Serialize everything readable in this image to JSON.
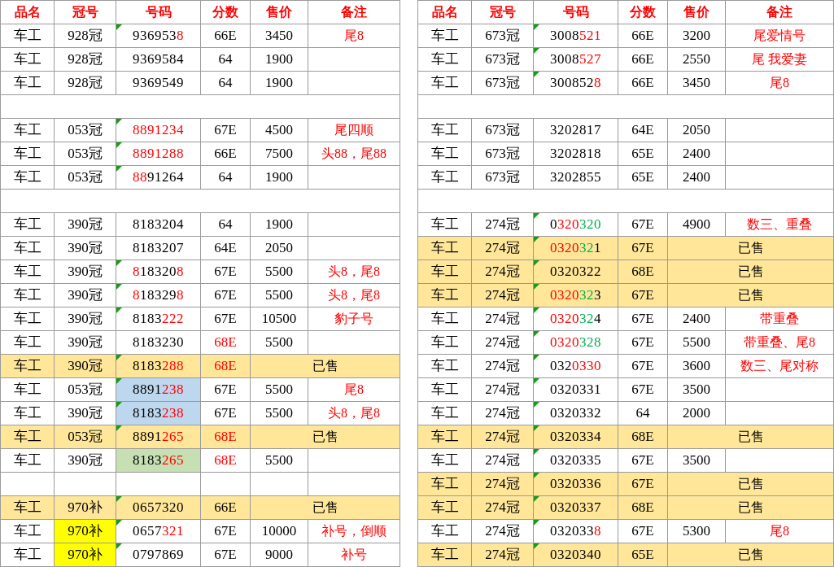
{
  "tables": [
    {
      "columns": [
        "品名",
        "冠号",
        "号码",
        "分数",
        "售价",
        "备注"
      ],
      "rows": [
        {
          "kind": "item",
          "name": "车工",
          "crown": {
            "text": "928冠"
          },
          "marker": true,
          "number": {
            "parts": [
              {
                "text": "936953"
              },
              {
                "text": "8",
                "color": "#ff0000"
              }
            ]
          },
          "score": {
            "text": "66E"
          },
          "price": "3450",
          "note": "尾8"
        },
        {
          "kind": "item",
          "name": "车工",
          "crown": {
            "text": "928冠"
          },
          "marker": false,
          "number": {
            "parts": [
              {
                "text": "9369584"
              }
            ]
          },
          "score": {
            "text": "64"
          },
          "price": "1900"
        },
        {
          "kind": "item",
          "name": "车工",
          "crown": {
            "text": "928冠"
          },
          "marker": false,
          "number": {
            "parts": [
              {
                "text": "9369549"
              }
            ]
          },
          "score": {
            "text": "64"
          },
          "price": "1900"
        },
        {
          "kind": "gap"
        },
        {
          "kind": "item",
          "name": "车工",
          "crown": {
            "text": "053冠"
          },
          "marker": true,
          "number": {
            "parts": [
              {
                "text": "8891234",
                "color": "#ff0000"
              }
            ]
          },
          "score": {
            "text": "67E"
          },
          "price": "4500",
          "note": "尾四顺"
        },
        {
          "kind": "item",
          "name": "车工",
          "crown": {
            "text": "053冠"
          },
          "marker": true,
          "number": {
            "parts": [
              {
                "text": "8891288",
                "color": "#ff0000"
              }
            ]
          },
          "score": {
            "text": "66E"
          },
          "price": "7500",
          "note": "头88，尾88"
        },
        {
          "kind": "item",
          "name": "车工",
          "crown": {
            "text": "053冠"
          },
          "marker": true,
          "number": {
            "parts": [
              {
                "text": "88",
                "color": "#ff0000"
              },
              {
                "text": "91264"
              }
            ]
          },
          "score": {
            "text": "64"
          },
          "price": "1900"
        },
        {
          "kind": "gap"
        },
        {
          "kind": "item",
          "name": "车工",
          "crown": {
            "text": "390冠"
          },
          "marker": false,
          "number": {
            "parts": [
              {
                "text": "8183204"
              }
            ]
          },
          "score": {
            "text": "64"
          },
          "price": "1900"
        },
        {
          "kind": "item",
          "name": "车工",
          "crown": {
            "text": "390冠"
          },
          "marker": false,
          "number": {
            "parts": [
              {
                "text": "8183207"
              }
            ]
          },
          "score": {
            "text": "64E"
          },
          "price": "2050"
        },
        {
          "kind": "item",
          "name": "车工",
          "crown": {
            "text": "390冠"
          },
          "marker": true,
          "number": {
            "parts": [
              {
                "text": "8",
                "color": "#ff0000"
              },
              {
                "text": "18320"
              },
              {
                "text": "8",
                "color": "#ff0000"
              }
            ]
          },
          "score": {
            "text": "67E"
          },
          "price": "5500",
          "note": "头8，尾8"
        },
        {
          "kind": "item",
          "name": "车工",
          "crown": {
            "text": "390冠"
          },
          "marker": true,
          "number": {
            "parts": [
              {
                "text": "8",
                "color": "#ff0000"
              },
              {
                "text": "18329"
              },
              {
                "text": "8",
                "color": "#ff0000"
              }
            ]
          },
          "score": {
            "text": "67E"
          },
          "price": "5500",
          "note": "头8，尾8"
        },
        {
          "kind": "item",
          "name": "车工",
          "crown": {
            "text": "390冠"
          },
          "marker": true,
          "number": {
            "parts": [
              {
                "text": "8183"
              },
              {
                "text": "222",
                "color": "#ff0000"
              }
            ]
          },
          "score": {
            "text": "67E"
          },
          "price": "10500",
          "note": "豹子号"
        },
        {
          "kind": "item",
          "name": "车工",
          "crown": {
            "text": "390冠"
          },
          "marker": false,
          "number": {
            "parts": [
              {
                "text": "8183230"
              }
            ]
          },
          "score": {
            "text": "68E",
            "color": "#ff0000"
          },
          "price": "5500"
        },
        {
          "kind": "sold",
          "name": "车工",
          "crown": {
            "text": "390冠"
          },
          "marker": true,
          "number": {
            "parts": [
              {
                "text": "8183"
              },
              {
                "text": "288",
                "color": "#ff0000"
              }
            ]
          },
          "score": {
            "text": "68E",
            "color": "#ff0000"
          },
          "status": "已售"
        },
        {
          "kind": "item",
          "name": "车工",
          "crown": {
            "text": "053冠"
          },
          "marker": true,
          "number": {
            "color": "#bdd7ee",
            "parts": [
              {
                "text": "8891"
              },
              {
                "text": "238",
                "color": "#ff0000"
              }
            ]
          },
          "score": {
            "text": "67E"
          },
          "price": "5500",
          "note": "尾8"
        },
        {
          "kind": "item",
          "name": "车工",
          "crown": {
            "text": "390冠"
          },
          "marker": true,
          "number": {
            "color": "#bdd7ee",
            "parts": [
              {
                "text": "8183"
              },
              {
                "text": "238",
                "color": "#ff0000"
              }
            ]
          },
          "score": {
            "text": "67E"
          },
          "price": "5500",
          "note": "头8，尾8"
        },
        {
          "kind": "sold",
          "name": "车工",
          "crown": {
            "text": "053冠"
          },
          "marker": true,
          "number": {
            "parts": [
              {
                "text": "8891"
              },
              {
                "text": "265",
                "color": "#ff0000"
              }
            ]
          },
          "score": {
            "text": "68E",
            "color": "#ff0000"
          },
          "status": "已售"
        },
        {
          "kind": "item",
          "name": "车工",
          "crown": {
            "text": "390冠"
          },
          "marker": false,
          "number": {
            "color": "#c6e0b4",
            "parts": [
              {
                "text": "8183"
              },
              {
                "text": "265",
                "color": "#ff0000"
              }
            ]
          },
          "score": {
            "text": "68E",
            "color": "#ff0000"
          },
          "price": "5500"
        },
        {
          "kind": "empty"
        },
        {
          "kind": "sold",
          "name": "车工",
          "crown": {
            "text": "970补"
          },
          "marker": true,
          "number": {
            "parts": [
              {
                "text": "0657320"
              }
            ]
          },
          "score": {
            "text": "66E"
          },
          "status": "已售"
        },
        {
          "kind": "item",
          "name": "车工",
          "crown": {
            "text": "970补",
            "color": "#ffff00"
          },
          "marker": true,
          "number": {
            "parts": [
              {
                "text": "0657"
              },
              {
                "text": "321",
                "color": "#ff0000"
              }
            ]
          },
          "score": {
            "text": "67E"
          },
          "price": "10000",
          "note": "补号，倒顺"
        },
        {
          "kind": "item",
          "name": "车工",
          "crown": {
            "text": "970补",
            "color": "#ffff00"
          },
          "marker": true,
          "number": {
            "parts": [
              {
                "text": "0797869"
              }
            ]
          },
          "score": {
            "text": "67E"
          },
          "price": "9000",
          "note": "补号"
        }
      ]
    },
    {
      "columns": [
        "品名",
        "冠号",
        "号码",
        "分数",
        "售价",
        "备注"
      ],
      "rows": [
        {
          "kind": "item",
          "name": "车工",
          "crown": {
            "text": "673冠"
          },
          "marker": true,
          "number": {
            "parts": [
              {
                "text": "3008"
              },
              {
                "text": "521",
                "color": "#ff0000"
              }
            ]
          },
          "score": {
            "text": "66E"
          },
          "price": "3200",
          "note": "尾爱情号"
        },
        {
          "kind": "item",
          "name": "车工",
          "crown": {
            "text": "673冠"
          },
          "marker": true,
          "number": {
            "parts": [
              {
                "text": "3008"
              },
              {
                "text": "527",
                "color": "#ff0000"
              }
            ]
          },
          "score": {
            "text": "66E"
          },
          "price": "2550",
          "note": "尾 我爱妻"
        },
        {
          "kind": "item",
          "name": "车工",
          "crown": {
            "text": "673冠"
          },
          "marker": true,
          "number": {
            "parts": [
              {
                "text": "300852"
              },
              {
                "text": "8",
                "color": "#ff0000"
              }
            ]
          },
          "score": {
            "text": "66E"
          },
          "price": "3450",
          "note": "尾8"
        },
        {
          "kind": "gap"
        },
        {
          "kind": "item",
          "name": "车工",
          "crown": {
            "text": "673冠"
          },
          "marker": false,
          "number": {
            "parts": [
              {
                "text": "3202817"
              }
            ]
          },
          "score": {
            "text": "64E"
          },
          "price": "2050"
        },
        {
          "kind": "item",
          "name": "车工",
          "crown": {
            "text": "673冠"
          },
          "marker": false,
          "number": {
            "parts": [
              {
                "text": "3202818"
              }
            ]
          },
          "score": {
            "text": "65E"
          },
          "price": "2400"
        },
        {
          "kind": "item",
          "name": "车工",
          "crown": {
            "text": "673冠"
          },
          "marker": false,
          "number": {
            "parts": [
              {
                "text": "3202855"
              }
            ]
          },
          "score": {
            "text": "65E"
          },
          "price": "2400"
        },
        {
          "kind": "gap"
        },
        {
          "kind": "item",
          "name": "车工",
          "crown": {
            "text": "274冠"
          },
          "marker": true,
          "number": {
            "parts": [
              {
                "text": "0"
              },
              {
                "text": "320",
                "color": "#ff0000"
              },
              {
                "text": "320",
                "color": "#00b050"
              }
            ]
          },
          "score": {
            "text": "67E"
          },
          "price": "4900",
          "note": "数三、重叠"
        },
        {
          "kind": "sold",
          "name": "车工",
          "crown": {
            "text": "274冠"
          },
          "marker": true,
          "number": {
            "parts": [
              {
                "text": "0320",
                "color": "#ff0000"
              },
              {
                "text": "32",
                "color": "#00b050"
              },
              {
                "text": "1"
              }
            ]
          },
          "score": {
            "text": "67E"
          },
          "status": "已售"
        },
        {
          "kind": "sold",
          "name": "车工",
          "crown": {
            "text": "274冠"
          },
          "marker": true,
          "number": {
            "parts": [
              {
                "text": "0320322"
              }
            ]
          },
          "score": {
            "text": "68E"
          },
          "status": "已售"
        },
        {
          "kind": "sold",
          "name": "车工",
          "crown": {
            "text": "274冠"
          },
          "marker": true,
          "number": {
            "parts": [
              {
                "text": "0320",
                "color": "#ff0000"
              },
              {
                "text": "32",
                "color": "#00b050"
              },
              {
                "text": "3"
              }
            ]
          },
          "score": {
            "text": "67E"
          },
          "status": "已售"
        },
        {
          "kind": "item",
          "name": "车工",
          "crown": {
            "text": "274冠"
          },
          "marker": true,
          "number": {
            "parts": [
              {
                "text": "0320",
                "color": "#ff0000"
              },
              {
                "text": "32",
                "color": "#00b050"
              },
              {
                "text": "4"
              }
            ]
          },
          "score": {
            "text": "67E"
          },
          "price": "2400",
          "note": "带重叠"
        },
        {
          "kind": "item",
          "name": "车工",
          "crown": {
            "text": "274冠"
          },
          "marker": true,
          "number": {
            "parts": [
              {
                "text": "0320",
                "color": "#ff0000"
              },
              {
                "text": "328",
                "color": "#00b050"
              }
            ]
          },
          "score": {
            "text": "67E"
          },
          "price": "5500",
          "note": "带重叠、尾8"
        },
        {
          "kind": "item",
          "name": "车工",
          "crown": {
            "text": "274冠"
          },
          "marker": true,
          "number": {
            "parts": [
              {
                "text": "032"
              },
              {
                "text": "0330",
                "color": "#ff0000"
              }
            ]
          },
          "score": {
            "text": "67E"
          },
          "price": "3600",
          "note": "数三、尾对称"
        },
        {
          "kind": "item",
          "name": "车工",
          "crown": {
            "text": "274冠"
          },
          "marker": true,
          "number": {
            "parts": [
              {
                "text": "0320331"
              }
            ]
          },
          "score": {
            "text": "67E"
          },
          "price": "3500"
        },
        {
          "kind": "item",
          "name": "车工",
          "crown": {
            "text": "274冠"
          },
          "marker": true,
          "number": {
            "parts": [
              {
                "text": "0320332"
              }
            ]
          },
          "score": {
            "text": "64"
          },
          "price": "2000"
        },
        {
          "kind": "sold",
          "name": "车工",
          "crown": {
            "text": "274冠"
          },
          "marker": true,
          "number": {
            "parts": [
              {
                "text": "0320334"
              }
            ]
          },
          "score": {
            "text": "68E"
          },
          "status": "已售"
        },
        {
          "kind": "item",
          "name": "车工",
          "crown": {
            "text": "274冠"
          },
          "marker": true,
          "number": {
            "parts": [
              {
                "text": "0320335"
              }
            ]
          },
          "score": {
            "text": "67E"
          },
          "price": "3500"
        },
        {
          "kind": "sold",
          "name": "车工",
          "crown": {
            "text": "274冠"
          },
          "marker": true,
          "number": {
            "parts": [
              {
                "text": "0320336"
              }
            ]
          },
          "score": {
            "text": "67E"
          },
          "status": "已售"
        },
        {
          "kind": "sold",
          "name": "车工",
          "crown": {
            "text": "274冠"
          },
          "marker": true,
          "number": {
            "parts": [
              {
                "text": "0320337"
              }
            ]
          },
          "score": {
            "text": "68E"
          },
          "status": "已售"
        },
        {
          "kind": "item",
          "name": "车工",
          "crown": {
            "text": "274冠"
          },
          "marker": true,
          "number": {
            "parts": [
              {
                "text": "032033"
              },
              {
                "text": "8",
                "color": "#ff0000"
              }
            ]
          },
          "score": {
            "text": "67E"
          },
          "price": "5300",
          "note": "尾8"
        },
        {
          "kind": "sold",
          "name": "车工",
          "crown": {
            "text": "274冠"
          },
          "marker": true,
          "number": {
            "parts": [
              {
                "text": "0320340"
              }
            ]
          },
          "score": {
            "text": "65E"
          },
          "status": "已售"
        }
      ]
    }
  ]
}
